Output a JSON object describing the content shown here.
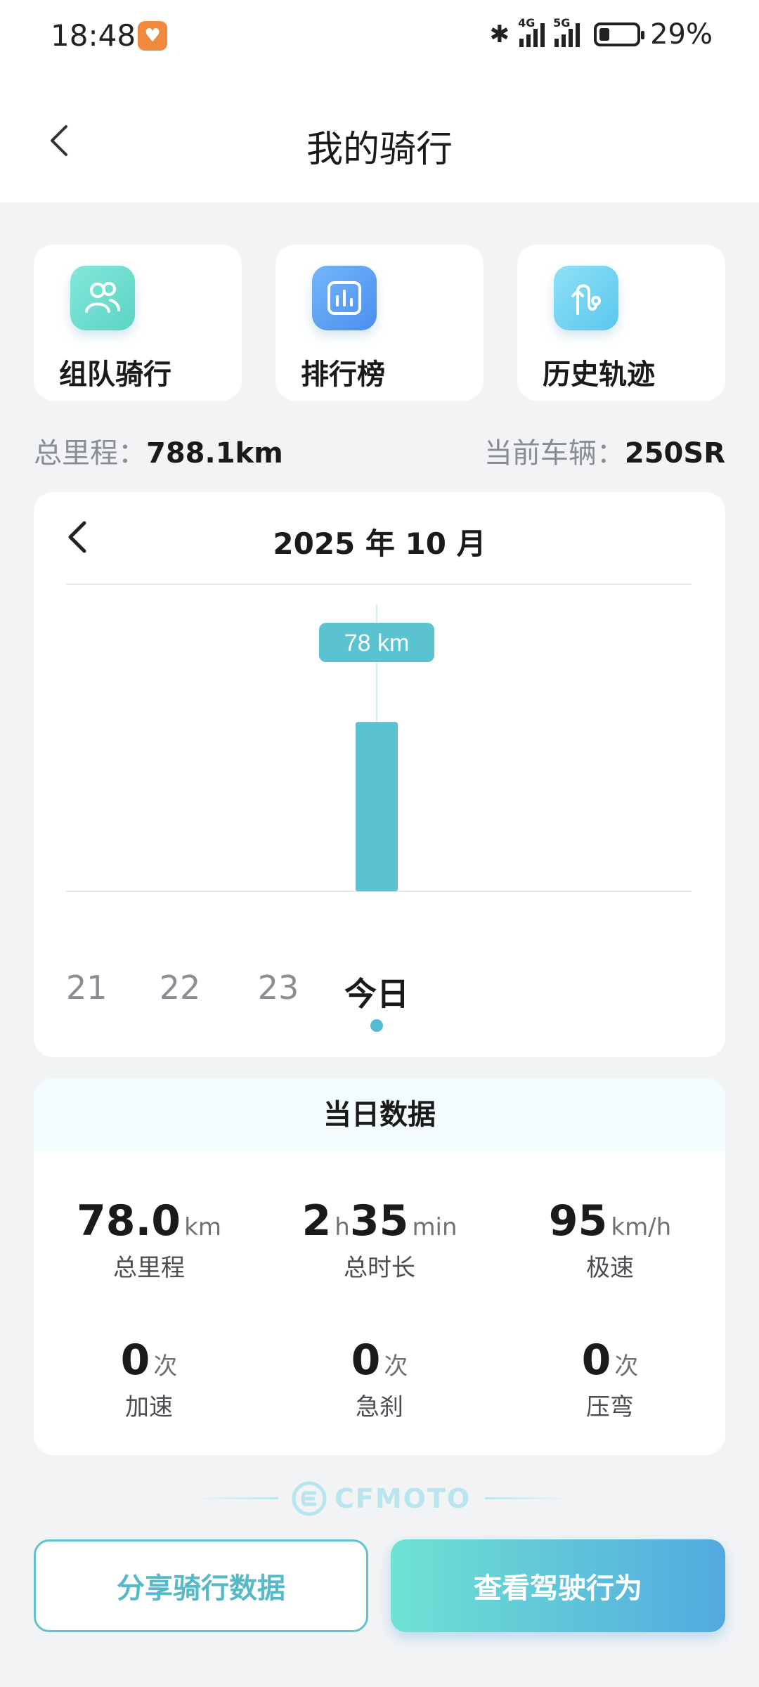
{
  "status_bar": {
    "time": "18:48",
    "battery_percent": "29%",
    "battery_level": 0.29,
    "network_1": "4G",
    "network_2": "5G"
  },
  "nav": {
    "title": "我的骑行"
  },
  "quick_actions": [
    {
      "label": "组队骑行",
      "icon": "team-riding-icon",
      "color_from": "#7de6d6",
      "color_to": "#5fd5c6"
    },
    {
      "label": "排行榜",
      "icon": "leaderboard-icon",
      "color_from": "#6fb1f7",
      "color_to": "#4a8ff0"
    },
    {
      "label": "历史轨迹",
      "icon": "history-track-icon",
      "color_from": "#84dcf3",
      "color_to": "#5cc8ee"
    }
  ],
  "summary": {
    "total_mileage_label": "总里程：",
    "total_mileage_value": "788.1km",
    "current_vehicle_label": "当前车辆：",
    "current_vehicle_value": "250SR"
  },
  "chart_header": {
    "month": "2025 年 10 月"
  },
  "chart_data": {
    "type": "bar",
    "categories": [
      "21",
      "22",
      "23",
      "今日"
    ],
    "values": [
      0,
      0,
      0,
      78
    ],
    "unit": "km",
    "selected_index": 3,
    "tooltip": "78 km",
    "ylim": [
      0,
      125
    ]
  },
  "day_stats": {
    "title": "当日数据",
    "items": [
      {
        "value": "78.0",
        "unit": "km",
        "label": "总里程"
      },
      {
        "value": "2",
        "unit": "h",
        "value2": "35",
        "unit2": "min",
        "label": "总时长"
      },
      {
        "value": "95",
        "unit": "km/h",
        "label": "极速"
      },
      {
        "value": "0",
        "unit": "次",
        "label": "加速"
      },
      {
        "value": "0",
        "unit": "次",
        "label": "急刹"
      },
      {
        "value": "0",
        "unit": "次",
        "label": "压弯"
      }
    ]
  },
  "brand": {
    "name": "CFMOTO"
  },
  "buttons": {
    "share": "分享骑行数据",
    "drive": "查看驾驶行为"
  },
  "colors": {
    "accent": "#56b9d2",
    "bar": "#5ac3cf",
    "tooltip_bg": "#5ac3cf"
  }
}
